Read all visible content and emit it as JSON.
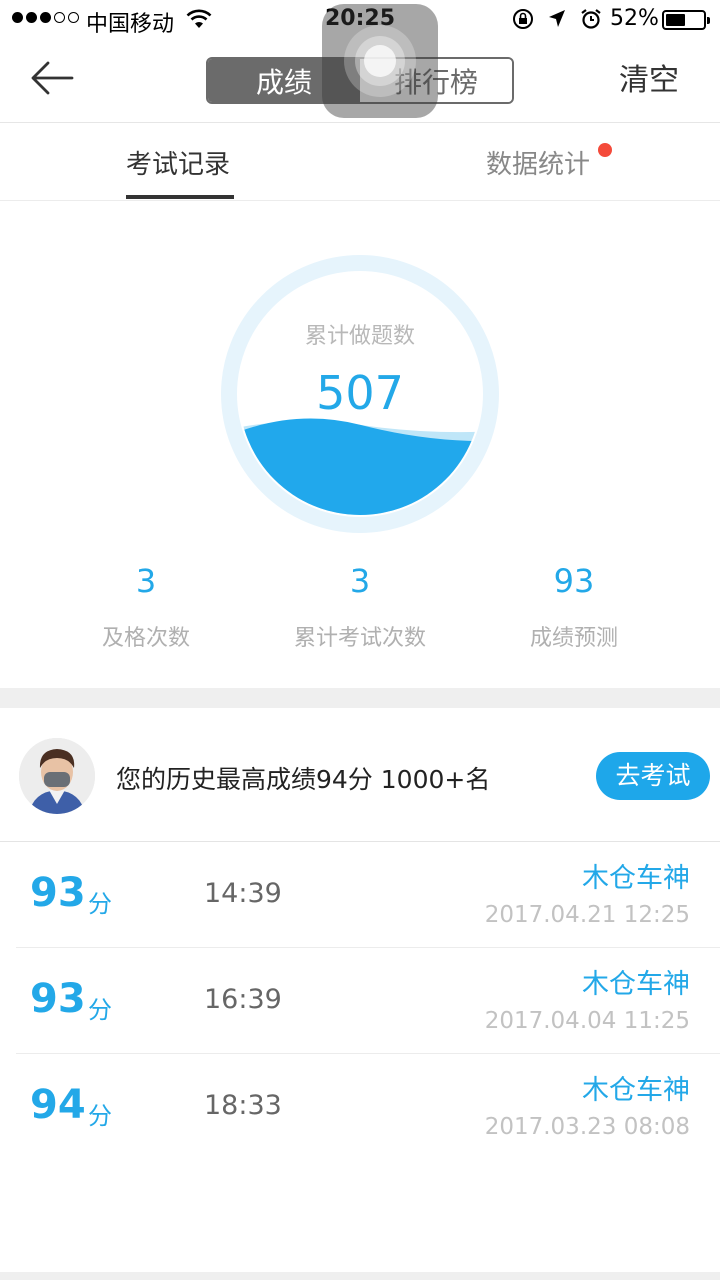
{
  "status_bar": {
    "carrier": "中国移动",
    "time": "20:25",
    "battery_percent": "52%",
    "battery_level": 0.52,
    "signal_bars_filled": 3,
    "signal_bars_total": 5
  },
  "nav": {
    "segments": [
      "成绩",
      "排行榜"
    ],
    "active_segment": 0,
    "clear_label": "清空"
  },
  "tabs": {
    "items": [
      "考试记录",
      "数据统计"
    ],
    "active": 0
  },
  "gauge": {
    "label": "累计做题数",
    "value": "507"
  },
  "stats": [
    {
      "value": "3",
      "label": "及格次数"
    },
    {
      "value": "3",
      "label": "累计考试次数"
    },
    {
      "value": "93",
      "label": "成绩预测"
    }
  ],
  "best": {
    "text": "您的历史最高成绩94分  1000+名",
    "button": "去考试"
  },
  "records": [
    {
      "score": "93",
      "unit": "分",
      "duration": "14:39",
      "name": "木仓车神",
      "date": "2017.04.21 12:25"
    },
    {
      "score": "93",
      "unit": "分",
      "duration": "16:39",
      "name": "木仓车神",
      "date": "2017.04.04 11:25"
    },
    {
      "score": "94",
      "unit": "分",
      "duration": "18:33",
      "name": "木仓车神",
      "date": "2017.03.23 08:08"
    }
  ],
  "colors": {
    "accent": "#23a8e8",
    "button": "#1ea7ea",
    "badge": "#f44a3a"
  }
}
